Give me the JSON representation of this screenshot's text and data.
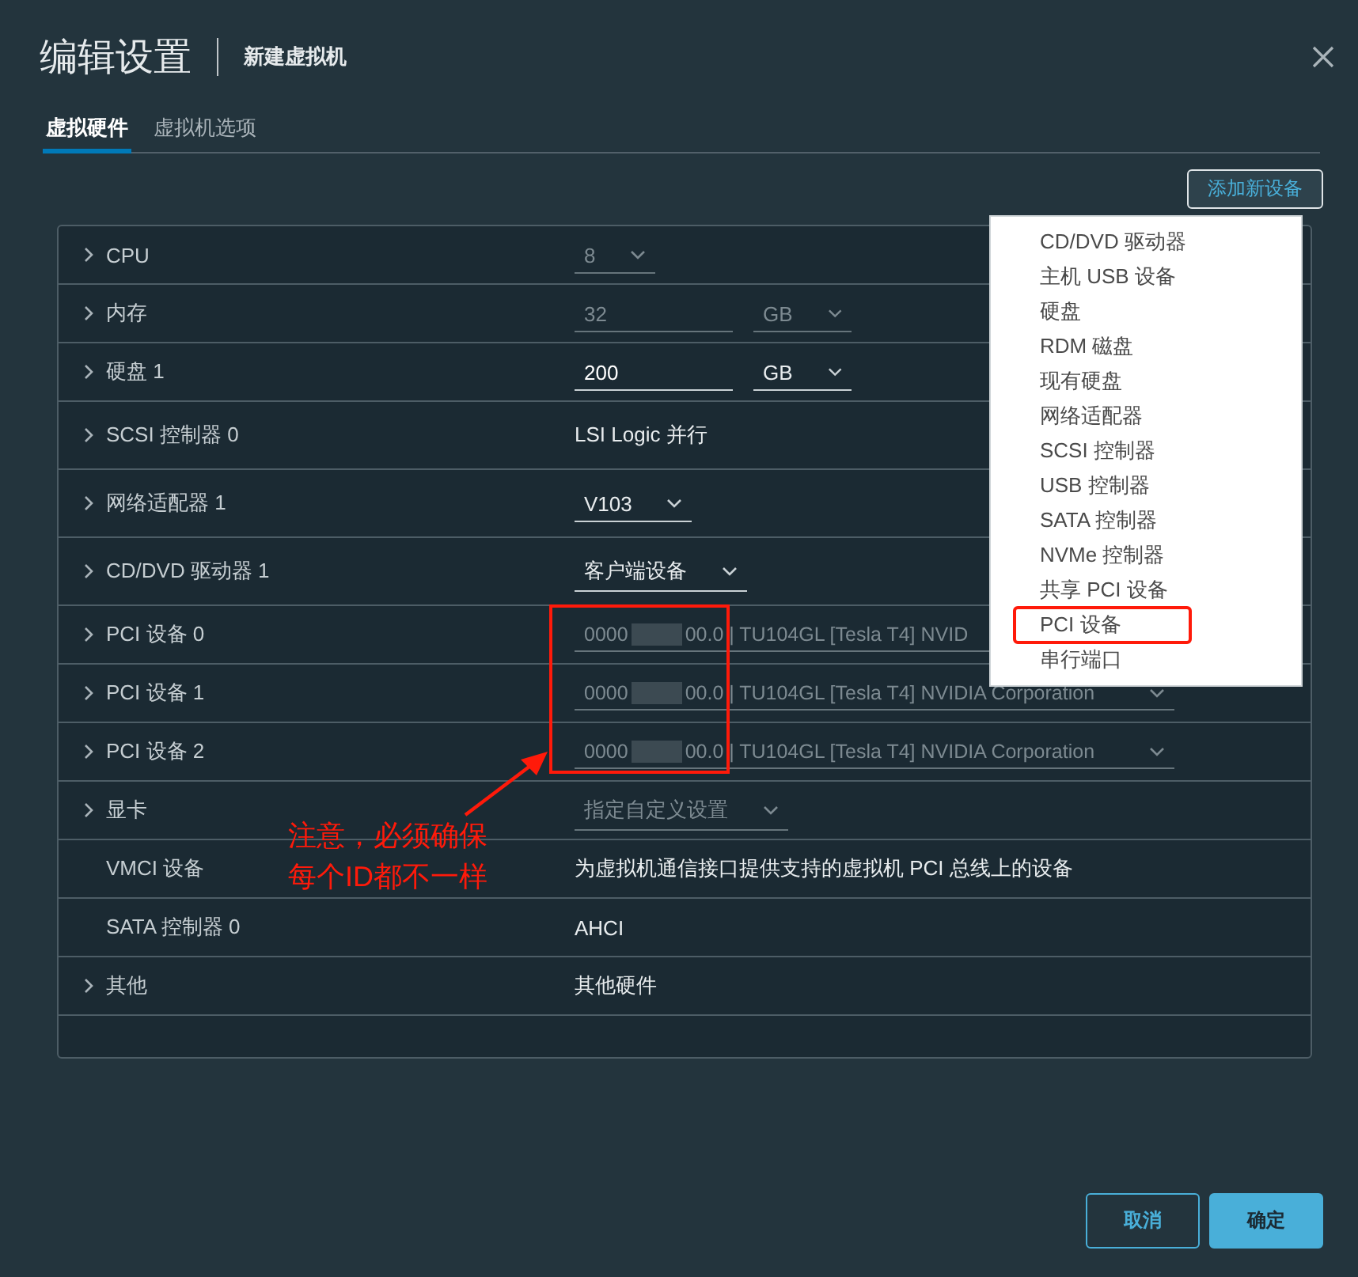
{
  "window": {
    "title": "编辑设置",
    "subtitle": "新建虚拟机"
  },
  "tabs": [
    {
      "label": "虚拟硬件",
      "selected": true
    },
    {
      "label": "虚拟机选项",
      "selected": false
    }
  ],
  "add_button": "添加新设备",
  "rows": [
    {
      "label": "CPU",
      "expandable": true,
      "kind": "select",
      "value": "8",
      "disabled": true
    },
    {
      "label": "内存",
      "expandable": true,
      "kind": "input_unit",
      "value": "32",
      "unit": "GB",
      "disabled": true
    },
    {
      "label": "硬盘 1",
      "expandable": true,
      "kind": "input_unit",
      "value": "200",
      "unit": "GB",
      "disabled": false
    },
    {
      "label": "SCSI 控制器 0",
      "expandable": true,
      "kind": "text",
      "value": "LSI Logic 并行"
    },
    {
      "label": "网络适配器 1",
      "expandable": true,
      "kind": "select",
      "value": "V103",
      "disabled": false
    },
    {
      "label": "CD/DVD 驱动器 1",
      "expandable": true,
      "kind": "select",
      "value": "客户端设备",
      "disabled": false
    },
    {
      "label": "PCI 设备 0",
      "expandable": true,
      "kind": "pci",
      "id_start": "0000",
      "value": "00.0 | TU104GL [Tesla T4] NVID",
      "disabled": true,
      "caret": false
    },
    {
      "label": "PCI 设备 1",
      "expandable": true,
      "kind": "pci",
      "id_start": "0000",
      "value": "00.0 | TU104GL [Tesla T4] NVIDIA Corporation",
      "disabled": true,
      "caret": true
    },
    {
      "label": "PCI 设备 2",
      "expandable": true,
      "kind": "pci",
      "id_start": "0000",
      "value": "00.0 | TU104GL [Tesla T4] NVIDIA Corporation",
      "disabled": true,
      "caret": true
    },
    {
      "label": "显卡",
      "expandable": true,
      "kind": "select",
      "value": "指定自定义设置",
      "disabled": true
    },
    {
      "label": "VMCI 设备",
      "expandable": false,
      "kind": "text",
      "value": "为虚拟机通信接口提供支持的虚拟机 PCI 总线上的设备"
    },
    {
      "label": "SATA 控制器 0",
      "expandable": false,
      "kind": "text",
      "value": "AHCI"
    },
    {
      "label": "其他",
      "expandable": true,
      "kind": "text",
      "value": "其他硬件"
    }
  ],
  "menu": [
    {
      "label": "CD/DVD 驱动器",
      "highlighted": false
    },
    {
      "label": "主机 USB 设备",
      "highlighted": false
    },
    {
      "label": "硬盘",
      "highlighted": false
    },
    {
      "label": "RDM 磁盘",
      "highlighted": false
    },
    {
      "label": "现有硬盘",
      "highlighted": false
    },
    {
      "label": "网络适配器",
      "highlighted": false
    },
    {
      "label": "SCSI 控制器",
      "highlighted": false
    },
    {
      "label": "USB 控制器",
      "highlighted": false
    },
    {
      "label": "SATA 控制器",
      "highlighted": false
    },
    {
      "label": "NVMe 控制器",
      "highlighted": false
    },
    {
      "label": "共享 PCI 设备",
      "highlighted": false
    },
    {
      "label": "PCI 设备",
      "highlighted": true
    },
    {
      "label": "串行端口",
      "highlighted": false
    }
  ],
  "annotation": {
    "lines": [
      "注意，必须确保",
      "每个ID都不一样"
    ]
  },
  "buttons": [
    {
      "label": "取消",
      "kind": "secondary"
    },
    {
      "label": "确定",
      "kind": "primary"
    }
  ]
}
